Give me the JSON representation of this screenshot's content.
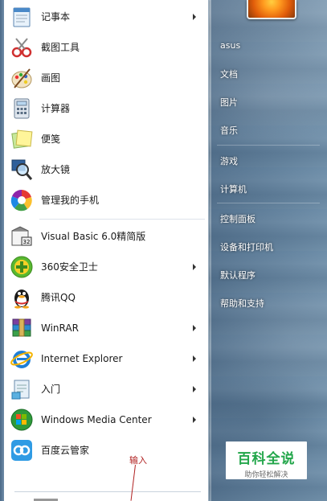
{
  "programs": [
    {
      "id": "notepad",
      "label": "记事本",
      "icon": "notepad-icon",
      "has_submenu": true
    },
    {
      "id": "snipping",
      "label": "截图工具",
      "icon": "snipping-tool-icon",
      "has_submenu": false
    },
    {
      "id": "paint",
      "label": "画图",
      "icon": "paint-icon",
      "has_submenu": false
    },
    {
      "id": "calc",
      "label": "计算器",
      "icon": "calculator-icon",
      "has_submenu": false
    },
    {
      "id": "sticky",
      "label": "便笺",
      "icon": "sticky-notes-icon",
      "has_submenu": false
    },
    {
      "id": "magnifier",
      "label": "放大镜",
      "icon": "magnifier-icon",
      "has_submenu": false
    },
    {
      "id": "phone",
      "label": "管理我的手机",
      "icon": "phone-manager-icon",
      "has_submenu": false
    },
    {
      "id": "vb",
      "label": "Visual Basic 6.0精简版",
      "icon": "visual-basic-icon",
      "has_submenu": false
    },
    {
      "id": "360",
      "label": "360安全卫士",
      "icon": "360-safe-icon",
      "has_submenu": true
    },
    {
      "id": "qq",
      "label": "腾讯QQ",
      "icon": "qq-penguin-icon",
      "has_submenu": false
    },
    {
      "id": "winrar",
      "label": "WinRAR",
      "icon": "winrar-icon",
      "has_submenu": true
    },
    {
      "id": "ie",
      "label": "Internet Explorer",
      "icon": "internet-explorer-icon",
      "has_submenu": true
    },
    {
      "id": "intro",
      "label": "入门",
      "icon": "getting-started-icon",
      "has_submenu": true
    },
    {
      "id": "wmc",
      "label": "Windows Media Center",
      "icon": "windows-media-center-icon",
      "has_submenu": true
    },
    {
      "id": "baidu",
      "label": "百度云管家",
      "icon": "baidu-cloud-icon",
      "has_submenu": false
    }
  ],
  "right_items": [
    {
      "id": "asus",
      "label": "asus"
    },
    {
      "id": "docs",
      "label": "文档"
    },
    {
      "id": "pics",
      "label": "图片"
    },
    {
      "id": "music",
      "label": "音乐"
    },
    {
      "id": "games",
      "label": "游戏"
    },
    {
      "id": "computer",
      "label": "计算机"
    },
    {
      "id": "control",
      "label": "控制面板"
    },
    {
      "id": "devices",
      "label": "设备和打印机"
    },
    {
      "id": "defaults",
      "label": "默认程序"
    },
    {
      "id": "help",
      "label": "帮助和支持"
    }
  ],
  "annotation": {
    "label": "输入"
  },
  "watermark": {
    "title": "百科全说",
    "subtitle": "助你轻松解决"
  },
  "colors": {
    "right_pane": "#3d6487",
    "watermark_green": "#22a64a",
    "annotation_red": "#b02020"
  }
}
